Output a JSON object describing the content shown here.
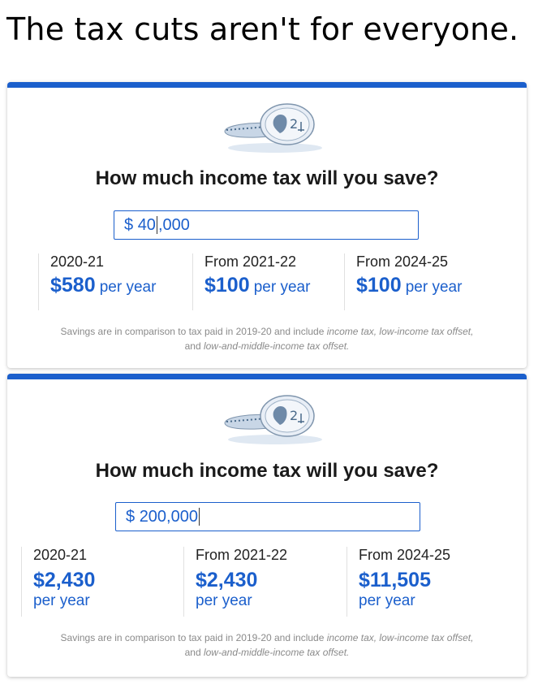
{
  "headline": "The tax cuts aren't for everyone.",
  "cards": [
    {
      "icon": "coin-stack-icon",
      "title": "How much income tax will you save?",
      "income": {
        "prefix": "$",
        "before_caret": "40",
        "after_caret": ",000",
        "value": "$ 40,000"
      },
      "columns": [
        {
          "label": "2020-21",
          "amount": "$580",
          "period": "per year"
        },
        {
          "label": "From 2021-22",
          "amount": "$100",
          "period": "per year"
        },
        {
          "label": "From 2024-25",
          "amount": "$100",
          "period": "per year"
        }
      ],
      "footnote": {
        "text1": "Savings are in comparison to tax paid in 2019-20 and include ",
        "em1": "income tax, low-income tax offset,",
        "text2": "and ",
        "em2": "low-and-middle-income tax offset."
      }
    },
    {
      "icon": "coin-stack-icon",
      "title": "How much income tax will you save?",
      "income": {
        "prefix": "$",
        "before_caret": "200,000",
        "after_caret": "",
        "value": "$ 200,000"
      },
      "columns": [
        {
          "label": "2020-21",
          "amount": "$2,430",
          "period": "per year"
        },
        {
          "label": "From 2021-22",
          "amount": "$2,430",
          "period": "per year"
        },
        {
          "label": "From 2024-25",
          "amount": "$11,505",
          "period": "per year"
        }
      ],
      "footnote": {
        "text1": "Savings are in comparison to tax paid in 2019-20 and include ",
        "em1": "income tax, low-income tax offset,",
        "text2": "and ",
        "em2": "low-and-middle-income tax offset."
      }
    }
  ],
  "colors": {
    "accent": "#1b5fcc",
    "muted": "#8a8a8a"
  }
}
